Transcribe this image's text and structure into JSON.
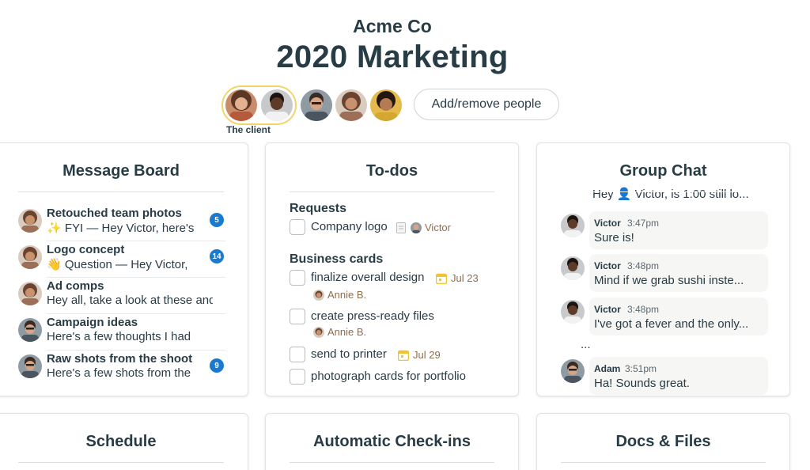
{
  "header": {
    "company": "Acme Co",
    "project_title": "2020 Marketing",
    "client_label": "The client",
    "add_people_label": "Add/remove people"
  },
  "people": [
    {
      "icon": "person-avatar",
      "skin": "#c98d6b",
      "hair": "#5a3825",
      "shirt": "#b55a3b"
    },
    {
      "icon": "person-avatar",
      "skin": "#5e3b28",
      "hair": "#1c130f",
      "shirt": "#d9d9d9"
    },
    {
      "icon": "person-avatar",
      "skin": "#d7a486",
      "hair": "#3b2a22",
      "shirt": "#4a5560"
    },
    {
      "icon": "person-avatar",
      "skin": "#c8926f",
      "hair": "#6b4431",
      "shirt": "#9d6f58"
    },
    {
      "icon": "person-avatar",
      "skin": "#b67a55",
      "hair": "#231712",
      "shirt": "#d4a632"
    }
  ],
  "message_board": {
    "title": "Message Board",
    "items": [
      {
        "title": "Retouched team photos",
        "excerpt": "✨ FYI — Hey Victor, here's",
        "badge": "5"
      },
      {
        "title": "Logo concept",
        "excerpt": "👋 Question — Hey Victor,",
        "badge": "14"
      },
      {
        "title": "Ad comps",
        "excerpt": "Hey all, take a look at these and",
        "badge": ""
      },
      {
        "title": "Campaign ideas",
        "excerpt": "Here's a few thoughts I had",
        "badge": ""
      },
      {
        "title": "Raw shots from the shoot",
        "excerpt": "Here's a few shots from the",
        "badge": "9"
      }
    ]
  },
  "todos": {
    "title": "To-dos",
    "groups": [
      {
        "title": "Requests"
      },
      {
        "title": "Business cards"
      }
    ],
    "items": [
      {
        "text": "Company logo",
        "assignee": "Victor"
      },
      {
        "text": "finalize overall design",
        "due": "Jul 23",
        "assignee": "Annie B."
      },
      {
        "text": "create press-ready files",
        "assignee": "Annie B."
      },
      {
        "text": "send to printer",
        "due": "Jul 29"
      },
      {
        "text": "photograph cards for portfolio"
      }
    ]
  },
  "group_chat": {
    "title": "Group Chat",
    "clipped_message": "Hey 👤 Victor, is 1:00 still lo...",
    "messages": [
      {
        "name": "Victor",
        "time": "3:47pm",
        "text": "Sure is!"
      },
      {
        "name": "Victor",
        "time": "3:48pm",
        "text": "Mind if we grab sushi inste..."
      },
      {
        "name": "Victor",
        "time": "3:48pm",
        "text": "I've got a fever and the only..."
      },
      {
        "name": "Adam",
        "time": "3:51pm",
        "text": "Ha! Sounds great."
      }
    ],
    "ellipsis": "..."
  },
  "lower_cards": {
    "schedule": "Schedule",
    "checkins": "Automatic Check-ins",
    "docs": "Docs & Files"
  },
  "colors": {
    "text": "#283c46",
    "badge": "#1a7ad0",
    "client_ring": "#f2d56b",
    "meta_brown": "#8d6e4f",
    "calendar": "#f2c434"
  }
}
